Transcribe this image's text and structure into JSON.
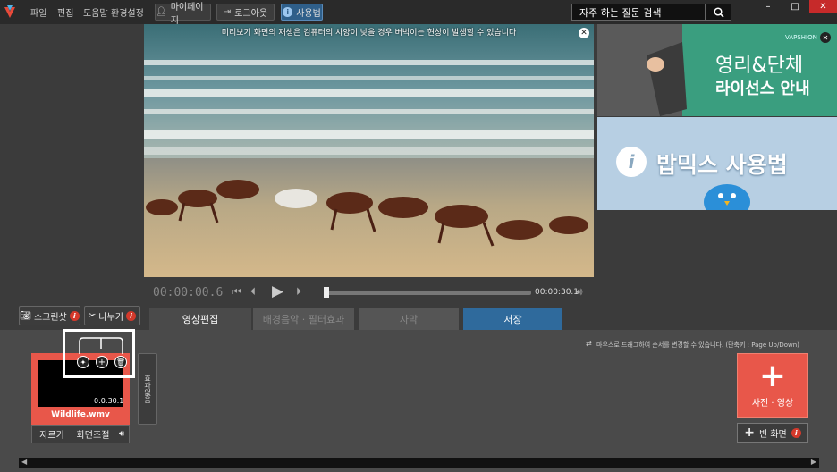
{
  "menu": {
    "file": "파일",
    "edit": "편집",
    "help": "도움말",
    "settings": "환경설정"
  },
  "toolbar": {
    "mypage": "마이페이지",
    "logout": "로그아웃",
    "howto": "사용법"
  },
  "search": {
    "placeholder": "자주 하는 질문 검색"
  },
  "preview": {
    "notice": "미리보기 화면의 재생은 컴퓨터의 사양이 낮을 경우 버벅이는 현상이 발생할 수 있습니다"
  },
  "ads": {
    "brand": "VAPSHION",
    "ad1_line1": "영리&단체",
    "ad1_line2": "라이선스 안내",
    "ad2_text": "밥믹스 사용법"
  },
  "player": {
    "current_time": "00:00:00.6",
    "total_time": "00:00:30.1",
    "progress": 0.0
  },
  "actions": {
    "screenshot": "스크린샷",
    "split": "나누기"
  },
  "tabs": [
    {
      "label": "영상편집"
    },
    {
      "label": "배경음악 · 필터효과"
    },
    {
      "label": "자막"
    },
    {
      "label": "저장"
    }
  ],
  "timeline": {
    "hint": "마우스로 드래그하여 순서를 변경할 수 있습니다. (단축키 : Page Up/Down)",
    "clip": {
      "duration": "0:0:30.1",
      "filename": "Wildlife.wmv",
      "trim": "자르기",
      "adjust": "화면조절"
    },
    "effect_label": "효과없음",
    "add_media": "사진 · 영상",
    "blank_screen": "빈 화면"
  },
  "colors": {
    "accent_red": "#e8574a",
    "tab_blue": "#2f6a9c",
    "ad_green": "#3a9e7f"
  }
}
